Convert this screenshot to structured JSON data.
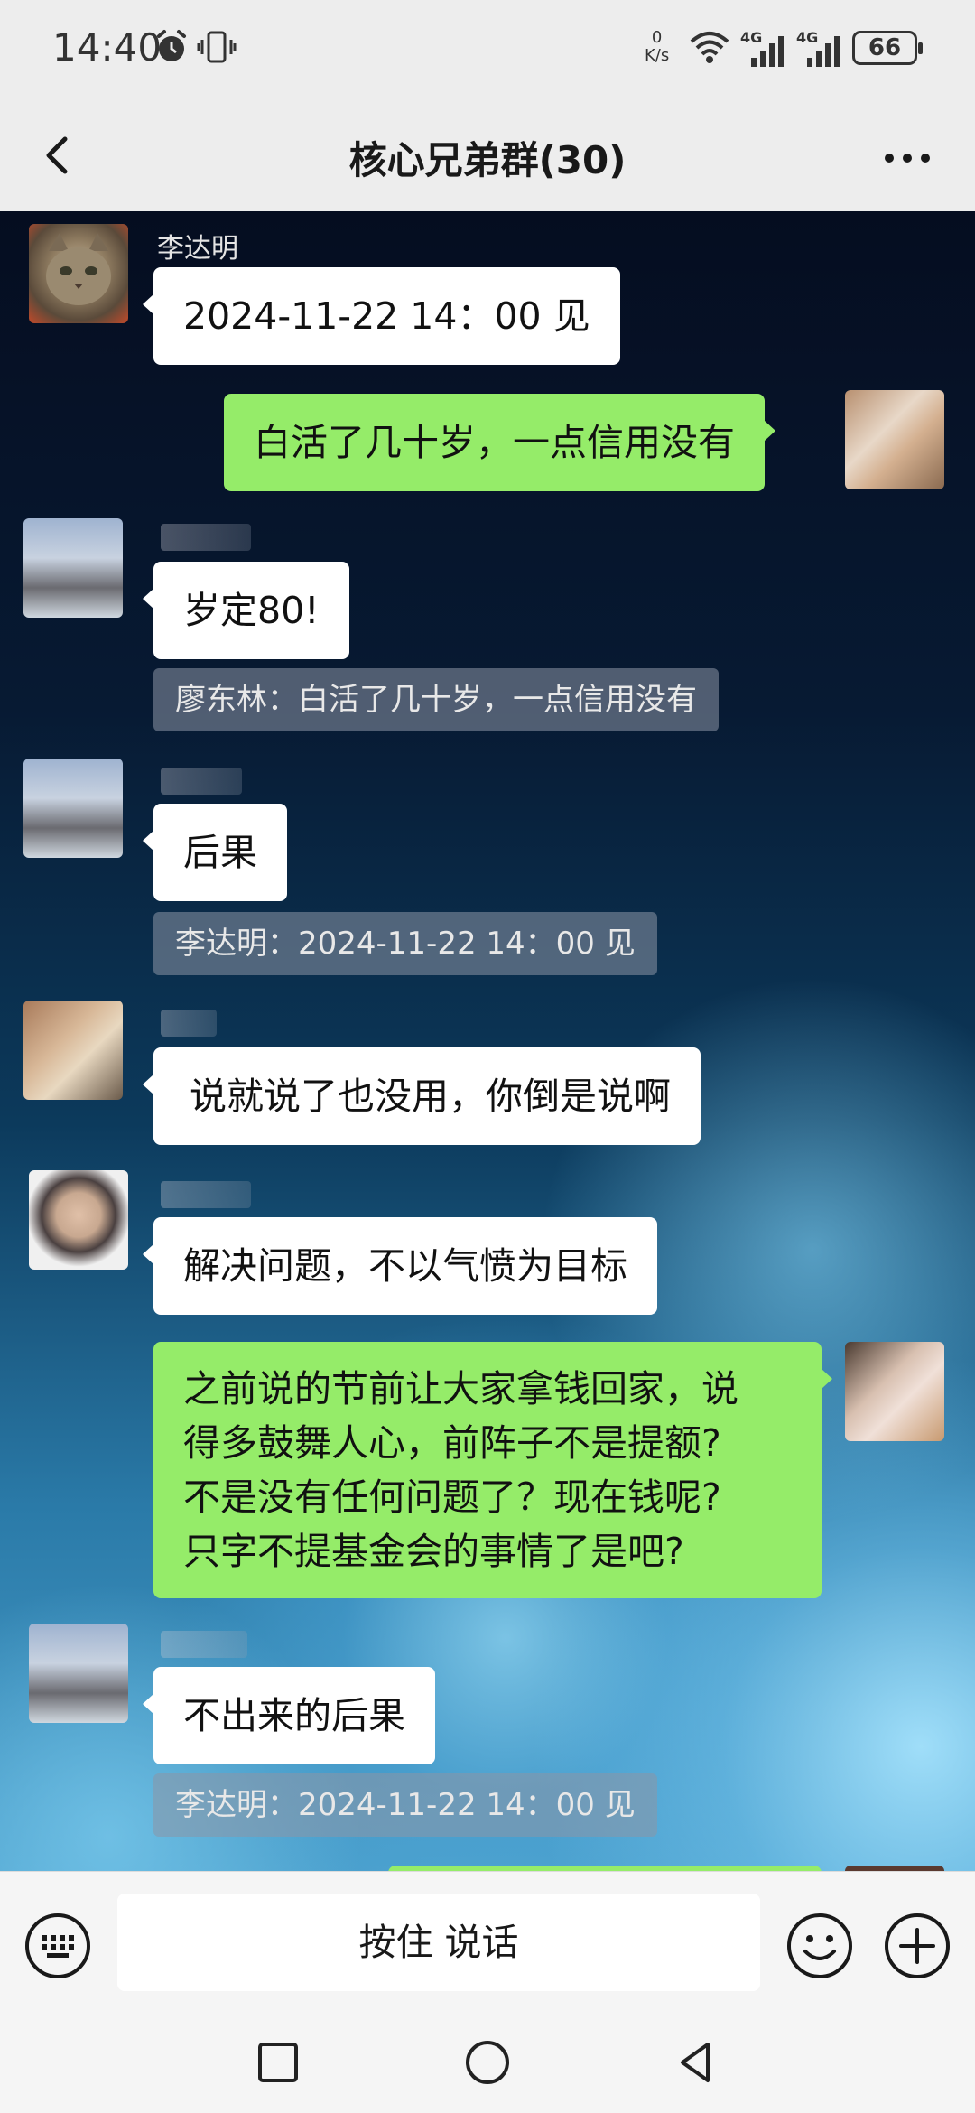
{
  "status_bar": {
    "time": "14:40",
    "net_speed_value": "0",
    "net_speed_unit": "K/s",
    "signal1_label": "4G",
    "signal2_label": "4G",
    "battery": "66"
  },
  "header": {
    "title": "核心兄弟群(30)"
  },
  "messages": [
    {
      "side": "left",
      "sender": "李达明",
      "text": "2024-11-22 14：00 见"
    },
    {
      "side": "right",
      "text": "白活了几十岁，一点信用没有"
    },
    {
      "side": "left",
      "text": "岁定80!",
      "quote": "廖东林：白活了几十岁，一点信用没有"
    },
    {
      "side": "left",
      "text": "后果",
      "quote": "李达明：2024-11-22 14：00 见"
    },
    {
      "side": "left",
      "text": "说就说了也没用，你倒是说啊"
    },
    {
      "side": "left",
      "text": "解决问题，不以气愤为目标"
    },
    {
      "side": "right",
      "lines": [
        "之前说的节前让大家拿钱回家，说",
        "得多鼓舞人心，前阵子不是提额?",
        "不是没有任何问题了？现在钱呢?",
        "只字不提基金会的事情了是吧?"
      ]
    },
    {
      "side": "left",
      "text": "不出来的后果",
      "quote": "李达明：2024-11-22 14：00 见"
    }
  ],
  "input_bar": {
    "hold_to_talk": "按住 说话"
  },
  "colors": {
    "own_bubble": "#95ec69",
    "other_bubble": "#ffffff",
    "header_bg": "#ededed"
  }
}
